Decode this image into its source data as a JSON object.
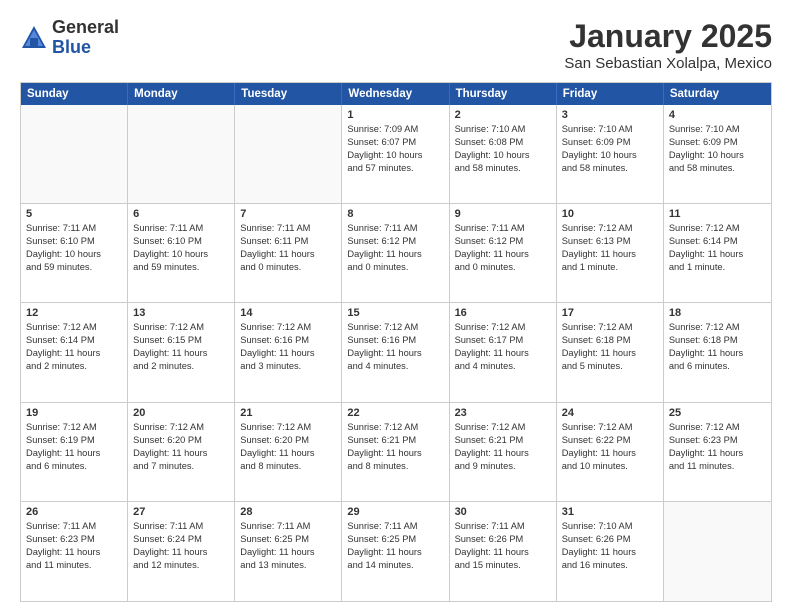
{
  "logo": {
    "general": "General",
    "blue": "Blue"
  },
  "title": "January 2025",
  "subtitle": "San Sebastian Xolalpa, Mexico",
  "header_days": [
    "Sunday",
    "Monday",
    "Tuesday",
    "Wednesday",
    "Thursday",
    "Friday",
    "Saturday"
  ],
  "weeks": [
    [
      {
        "day": "",
        "lines": []
      },
      {
        "day": "",
        "lines": []
      },
      {
        "day": "",
        "lines": []
      },
      {
        "day": "1",
        "lines": [
          "Sunrise: 7:09 AM",
          "Sunset: 6:07 PM",
          "Daylight: 10 hours",
          "and 57 minutes."
        ]
      },
      {
        "day": "2",
        "lines": [
          "Sunrise: 7:10 AM",
          "Sunset: 6:08 PM",
          "Daylight: 10 hours",
          "and 58 minutes."
        ]
      },
      {
        "day": "3",
        "lines": [
          "Sunrise: 7:10 AM",
          "Sunset: 6:09 PM",
          "Daylight: 10 hours",
          "and 58 minutes."
        ]
      },
      {
        "day": "4",
        "lines": [
          "Sunrise: 7:10 AM",
          "Sunset: 6:09 PM",
          "Daylight: 10 hours",
          "and 58 minutes."
        ]
      }
    ],
    [
      {
        "day": "5",
        "lines": [
          "Sunrise: 7:11 AM",
          "Sunset: 6:10 PM",
          "Daylight: 10 hours",
          "and 59 minutes."
        ]
      },
      {
        "day": "6",
        "lines": [
          "Sunrise: 7:11 AM",
          "Sunset: 6:10 PM",
          "Daylight: 10 hours",
          "and 59 minutes."
        ]
      },
      {
        "day": "7",
        "lines": [
          "Sunrise: 7:11 AM",
          "Sunset: 6:11 PM",
          "Daylight: 11 hours",
          "and 0 minutes."
        ]
      },
      {
        "day": "8",
        "lines": [
          "Sunrise: 7:11 AM",
          "Sunset: 6:12 PM",
          "Daylight: 11 hours",
          "and 0 minutes."
        ]
      },
      {
        "day": "9",
        "lines": [
          "Sunrise: 7:11 AM",
          "Sunset: 6:12 PM",
          "Daylight: 11 hours",
          "and 0 minutes."
        ]
      },
      {
        "day": "10",
        "lines": [
          "Sunrise: 7:12 AM",
          "Sunset: 6:13 PM",
          "Daylight: 11 hours",
          "and 1 minute."
        ]
      },
      {
        "day": "11",
        "lines": [
          "Sunrise: 7:12 AM",
          "Sunset: 6:14 PM",
          "Daylight: 11 hours",
          "and 1 minute."
        ]
      }
    ],
    [
      {
        "day": "12",
        "lines": [
          "Sunrise: 7:12 AM",
          "Sunset: 6:14 PM",
          "Daylight: 11 hours",
          "and 2 minutes."
        ]
      },
      {
        "day": "13",
        "lines": [
          "Sunrise: 7:12 AM",
          "Sunset: 6:15 PM",
          "Daylight: 11 hours",
          "and 2 minutes."
        ]
      },
      {
        "day": "14",
        "lines": [
          "Sunrise: 7:12 AM",
          "Sunset: 6:16 PM",
          "Daylight: 11 hours",
          "and 3 minutes."
        ]
      },
      {
        "day": "15",
        "lines": [
          "Sunrise: 7:12 AM",
          "Sunset: 6:16 PM",
          "Daylight: 11 hours",
          "and 4 minutes."
        ]
      },
      {
        "day": "16",
        "lines": [
          "Sunrise: 7:12 AM",
          "Sunset: 6:17 PM",
          "Daylight: 11 hours",
          "and 4 minutes."
        ]
      },
      {
        "day": "17",
        "lines": [
          "Sunrise: 7:12 AM",
          "Sunset: 6:18 PM",
          "Daylight: 11 hours",
          "and 5 minutes."
        ]
      },
      {
        "day": "18",
        "lines": [
          "Sunrise: 7:12 AM",
          "Sunset: 6:18 PM",
          "Daylight: 11 hours",
          "and 6 minutes."
        ]
      }
    ],
    [
      {
        "day": "19",
        "lines": [
          "Sunrise: 7:12 AM",
          "Sunset: 6:19 PM",
          "Daylight: 11 hours",
          "and 6 minutes."
        ]
      },
      {
        "day": "20",
        "lines": [
          "Sunrise: 7:12 AM",
          "Sunset: 6:20 PM",
          "Daylight: 11 hours",
          "and 7 minutes."
        ]
      },
      {
        "day": "21",
        "lines": [
          "Sunrise: 7:12 AM",
          "Sunset: 6:20 PM",
          "Daylight: 11 hours",
          "and 8 minutes."
        ]
      },
      {
        "day": "22",
        "lines": [
          "Sunrise: 7:12 AM",
          "Sunset: 6:21 PM",
          "Daylight: 11 hours",
          "and 8 minutes."
        ]
      },
      {
        "day": "23",
        "lines": [
          "Sunrise: 7:12 AM",
          "Sunset: 6:21 PM",
          "Daylight: 11 hours",
          "and 9 minutes."
        ]
      },
      {
        "day": "24",
        "lines": [
          "Sunrise: 7:12 AM",
          "Sunset: 6:22 PM",
          "Daylight: 11 hours",
          "and 10 minutes."
        ]
      },
      {
        "day": "25",
        "lines": [
          "Sunrise: 7:12 AM",
          "Sunset: 6:23 PM",
          "Daylight: 11 hours",
          "and 11 minutes."
        ]
      }
    ],
    [
      {
        "day": "26",
        "lines": [
          "Sunrise: 7:11 AM",
          "Sunset: 6:23 PM",
          "Daylight: 11 hours",
          "and 11 minutes."
        ]
      },
      {
        "day": "27",
        "lines": [
          "Sunrise: 7:11 AM",
          "Sunset: 6:24 PM",
          "Daylight: 11 hours",
          "and 12 minutes."
        ]
      },
      {
        "day": "28",
        "lines": [
          "Sunrise: 7:11 AM",
          "Sunset: 6:25 PM",
          "Daylight: 11 hours",
          "and 13 minutes."
        ]
      },
      {
        "day": "29",
        "lines": [
          "Sunrise: 7:11 AM",
          "Sunset: 6:25 PM",
          "Daylight: 11 hours",
          "and 14 minutes."
        ]
      },
      {
        "day": "30",
        "lines": [
          "Sunrise: 7:11 AM",
          "Sunset: 6:26 PM",
          "Daylight: 11 hours",
          "and 15 minutes."
        ]
      },
      {
        "day": "31",
        "lines": [
          "Sunrise: 7:10 AM",
          "Sunset: 6:26 PM",
          "Daylight: 11 hours",
          "and 16 minutes."
        ]
      },
      {
        "day": "",
        "lines": []
      }
    ]
  ]
}
